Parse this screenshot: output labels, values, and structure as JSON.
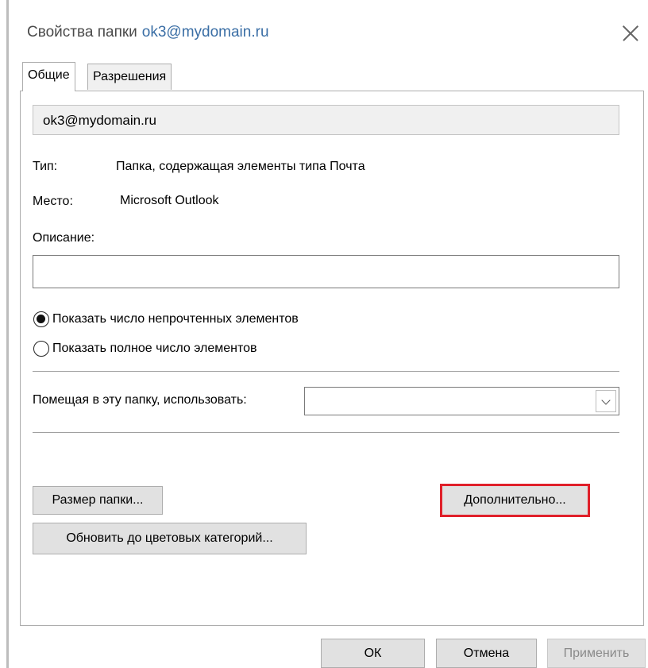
{
  "window": {
    "title_prefix": "Свойства папки",
    "title_account": "ok3@mydomain.ru"
  },
  "tabs": [
    {
      "label": "Общие",
      "active": true
    },
    {
      "label": "Разрешения",
      "active": false
    }
  ],
  "general": {
    "folder_name": "ok3@mydomain.ru",
    "type_label": "Тип:",
    "type_value": "Папка, содержащая элементы типа Почта",
    "location_label": "Место:",
    "location_value": "Microsoft Outlook",
    "description_label": "Описание:",
    "description_value": "",
    "radio_unread_label": "Показать число непрочтенных элементов",
    "radio_total_label": "Показать полное число элементов",
    "radio_selected": "unread",
    "post_using_label": "Помещая в эту папку, использовать:",
    "post_using_value": "",
    "folder_size_button": "Размер папки...",
    "advanced_button": "Дополнительно...",
    "upgrade_categories_button": "Обновить до цветовых категорий..."
  },
  "footer": {
    "ok": "ОК",
    "cancel": "Отмена",
    "apply": "Применить"
  },
  "colors": {
    "highlight_border": "#e0202a",
    "title_account": "#3a6ea5"
  },
  "icons": [
    "close-icon",
    "chevron-down-icon",
    "radio-checked-icon",
    "radio-unchecked-icon"
  ]
}
